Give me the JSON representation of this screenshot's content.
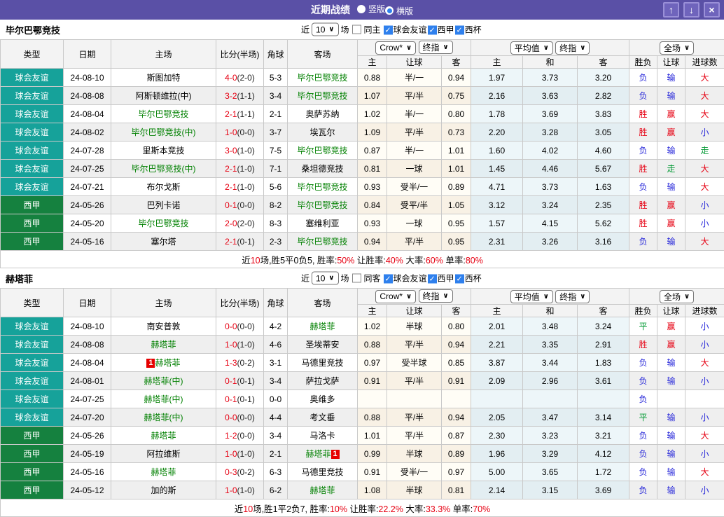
{
  "colors": {
    "titlebar": "#5A50A6",
    "badge_teal": "#16A29A",
    "badge_green": "#15813F",
    "result_red": "#E60012",
    "result_blue": "#2626D9",
    "result_green": "#009933",
    "team_green": "#008000",
    "check_blue": "#2F80ED"
  },
  "titlebar": {
    "title": "近期战绩",
    "radios": [
      {
        "label": "竖版",
        "selected": false
      },
      {
        "label": "横版",
        "selected": true
      }
    ],
    "buttons": [
      {
        "name": "scroll-up",
        "icon": "up-arrow-icon",
        "glyph": "↑"
      },
      {
        "name": "scroll-down",
        "icon": "down-arrow-icon",
        "glyph": "↓"
      },
      {
        "name": "close",
        "icon": "close-icon",
        "glyph": "×"
      }
    ]
  },
  "table": {
    "main_cols": [
      "类型",
      "日期",
      "主场",
      "比分(半场)",
      "角球",
      "客场"
    ],
    "sub_cols": [
      "主",
      "让球",
      "客",
      "主",
      "和",
      "客",
      "胜负",
      "让球",
      "进球数"
    ],
    "selects": {
      "bookmaker": "Crow*",
      "final1": "终指",
      "average": "平均值",
      "final2": "终指",
      "scope": "全场"
    }
  },
  "sections": [
    {
      "team": "毕尔巴鄂竞技",
      "filter": {
        "near": "近",
        "count": "10",
        "games": "场",
        "same": "同主",
        "same_checked": false,
        "leagues": [
          {
            "label": "球会友谊",
            "checked": true
          },
          {
            "label": "西甲",
            "checked": true
          },
          {
            "label": "西杯",
            "checked": true
          }
        ]
      },
      "rows": [
        {
          "type": "球会友谊",
          "tc": "teal",
          "date": "24-08-10",
          "home": {
            "t": "斯图加特"
          },
          "score": "4-0",
          "half": "(2-0)",
          "corner": "5-3",
          "away": {
            "t": "毕尔巴鄂竞技",
            "g": 1
          },
          "odds": [
            "0.88",
            "半/一",
            "0.94"
          ],
          "avg": [
            "1.97",
            "3.73",
            "3.20"
          ],
          "res": [
            [
              "负",
              "b"
            ],
            [
              "输",
              "b"
            ],
            [
              "大",
              "r"
            ]
          ]
        },
        {
          "type": "球会友谊",
          "tc": "teal",
          "date": "24-08-08",
          "home": {
            "t": "阿斯顿维拉(中)"
          },
          "score": "3-2",
          "half": "(1-1)",
          "corner": "3-4",
          "away": {
            "t": "毕尔巴鄂竞技",
            "g": 1
          },
          "odds": [
            "1.07",
            "平/半",
            "0.75"
          ],
          "avg": [
            "2.16",
            "3.63",
            "2.82"
          ],
          "res": [
            [
              "负",
              "b"
            ],
            [
              "输",
              "b"
            ],
            [
              "大",
              "r"
            ]
          ]
        },
        {
          "type": "球会友谊",
          "tc": "teal",
          "date": "24-08-04",
          "home": {
            "t": "毕尔巴鄂竞技",
            "g": 1
          },
          "score": "2-1",
          "half": "(1-1)",
          "corner": "2-1",
          "away": {
            "t": "奥萨苏纳"
          },
          "odds": [
            "1.02",
            "半/一",
            "0.80"
          ],
          "avg": [
            "1.78",
            "3.69",
            "3.83"
          ],
          "res": [
            [
              "胜",
              "r"
            ],
            [
              "赢",
              "r"
            ],
            [
              "大",
              "r"
            ]
          ]
        },
        {
          "type": "球会友谊",
          "tc": "teal",
          "date": "24-08-02",
          "home": {
            "t": "毕尔巴鄂竞技(中)",
            "g": 1
          },
          "score": "1-0",
          "half": "(0-0)",
          "corner": "3-7",
          "away": {
            "t": "埃瓦尔"
          },
          "odds": [
            "1.09",
            "平/半",
            "0.73"
          ],
          "avg": [
            "2.20",
            "3.28",
            "3.05"
          ],
          "res": [
            [
              "胜",
              "r"
            ],
            [
              "赢",
              "r"
            ],
            [
              "小",
              "b"
            ]
          ]
        },
        {
          "type": "球会友谊",
          "tc": "teal",
          "date": "24-07-28",
          "home": {
            "t": "里斯本竞技"
          },
          "score": "3-0",
          "half": "(1-0)",
          "corner": "7-5",
          "away": {
            "t": "毕尔巴鄂竞技",
            "g": 1
          },
          "odds": [
            "0.87",
            "半/一",
            "1.01"
          ],
          "avg": [
            "1.60",
            "4.02",
            "4.60"
          ],
          "res": [
            [
              "负",
              "b"
            ],
            [
              "输",
              "b"
            ],
            [
              "走",
              "g"
            ]
          ]
        },
        {
          "type": "球会友谊",
          "tc": "teal",
          "date": "24-07-25",
          "home": {
            "t": "毕尔巴鄂竞技(中)",
            "g": 1
          },
          "score": "2-1",
          "half": "(1-0)",
          "corner": "7-1",
          "away": {
            "t": "桑坦德竞技"
          },
          "odds": [
            "0.81",
            "一球",
            "1.01"
          ],
          "avg": [
            "1.45",
            "4.46",
            "5.67"
          ],
          "res": [
            [
              "胜",
              "r"
            ],
            [
              "走",
              "g"
            ],
            [
              "大",
              "r"
            ]
          ]
        },
        {
          "type": "球会友谊",
          "tc": "teal",
          "date": "24-07-21",
          "home": {
            "t": "布尔戈斯"
          },
          "score": "2-1",
          "half": "(1-0)",
          "corner": "5-6",
          "away": {
            "t": "毕尔巴鄂竞技",
            "g": 1
          },
          "odds": [
            "0.93",
            "受半/一",
            "0.89"
          ],
          "avg": [
            "4.71",
            "3.73",
            "1.63"
          ],
          "res": [
            [
              "负",
              "b"
            ],
            [
              "输",
              "b"
            ],
            [
              "大",
              "r"
            ]
          ]
        },
        {
          "type": "西甲",
          "tc": "green",
          "date": "24-05-26",
          "home": {
            "t": "巴列卡诺"
          },
          "score": "0-1",
          "half": "(0-0)",
          "corner": "8-2",
          "away": {
            "t": "毕尔巴鄂竞技",
            "g": 1
          },
          "odds": [
            "0.84",
            "受平/半",
            "1.05"
          ],
          "avg": [
            "3.12",
            "3.24",
            "2.35"
          ],
          "res": [
            [
              "胜",
              "r"
            ],
            [
              "赢",
              "r"
            ],
            [
              "小",
              "b"
            ]
          ]
        },
        {
          "type": "西甲",
          "tc": "green",
          "date": "24-05-20",
          "home": {
            "t": "毕尔巴鄂竞技",
            "g": 1
          },
          "score": "2-0",
          "half": "(2-0)",
          "corner": "8-3",
          "away": {
            "t": "塞维利亚"
          },
          "odds": [
            "0.93",
            "一球",
            "0.95"
          ],
          "avg": [
            "1.57",
            "4.15",
            "5.62"
          ],
          "res": [
            [
              "胜",
              "r"
            ],
            [
              "赢",
              "r"
            ],
            [
              "小",
              "b"
            ]
          ]
        },
        {
          "type": "西甲",
          "tc": "green",
          "date": "24-05-16",
          "home": {
            "t": "塞尔塔"
          },
          "score": "2-1",
          "half": "(0-1)",
          "corner": "2-3",
          "away": {
            "t": "毕尔巴鄂竞技",
            "g": 1
          },
          "odds": [
            "0.94",
            "平/半",
            "0.95"
          ],
          "avg": [
            "2.31",
            "3.26",
            "3.16"
          ],
          "res": [
            [
              "负",
              "b"
            ],
            [
              "输",
              "b"
            ],
            [
              "大",
              "r"
            ]
          ]
        }
      ],
      "summary": [
        [
          "近",
          "k"
        ],
        [
          "10",
          "r"
        ],
        [
          "场,胜5平0负5, 胜率:",
          "k"
        ],
        [
          "50%",
          "r"
        ],
        [
          " 让胜率:",
          "k"
        ],
        [
          "40%",
          "r"
        ],
        [
          " 大率:",
          "k"
        ],
        [
          "60%",
          "r"
        ],
        [
          " 单率:",
          "k"
        ],
        [
          "80%",
          "r"
        ]
      ]
    },
    {
      "team": "赫塔菲",
      "filter": {
        "near": "近",
        "count": "10",
        "games": "场",
        "same": "同客",
        "same_checked": false,
        "leagues": [
          {
            "label": "球会友谊",
            "checked": true
          },
          {
            "label": "西甲",
            "checked": true
          },
          {
            "label": "西杯",
            "checked": true
          }
        ]
      },
      "rows": [
        {
          "type": "球会友谊",
          "tc": "teal",
          "date": "24-08-10",
          "home": {
            "t": "南安普敦"
          },
          "score": "0-0",
          "half": "(0-0)",
          "corner": "4-2",
          "away": {
            "t": "赫塔菲",
            "g": 1
          },
          "odds": [
            "1.02",
            "半球",
            "0.80"
          ],
          "avg": [
            "2.01",
            "3.48",
            "3.24"
          ],
          "res": [
            [
              "平",
              "g"
            ],
            [
              "赢",
              "r"
            ],
            [
              "小",
              "b"
            ]
          ]
        },
        {
          "type": "球会友谊",
          "tc": "teal",
          "date": "24-08-08",
          "home": {
            "t": "赫塔菲",
            "g": 1
          },
          "score": "1-0",
          "half": "(1-0)",
          "corner": "4-6",
          "away": {
            "t": "圣埃蒂安"
          },
          "odds": [
            "0.88",
            "平/半",
            "0.94"
          ],
          "avg": [
            "2.21",
            "3.35",
            "2.91"
          ],
          "res": [
            [
              "胜",
              "r"
            ],
            [
              "赢",
              "r"
            ],
            [
              "小",
              "b"
            ]
          ]
        },
        {
          "type": "球会友谊",
          "tc": "teal",
          "date": "24-08-04",
          "home": {
            "t": "赫塔菲",
            "g": 1,
            "rc": {
              "text": "1",
              "pos": "before"
            }
          },
          "score": "1-3",
          "half": "(0-2)",
          "corner": "3-1",
          "away": {
            "t": "马德里竞技"
          },
          "odds": [
            "0.97",
            "受半球",
            "0.85"
          ],
          "avg": [
            "3.87",
            "3.44",
            "1.83"
          ],
          "res": [
            [
              "负",
              "b"
            ],
            [
              "输",
              "b"
            ],
            [
              "大",
              "r"
            ]
          ]
        },
        {
          "type": "球会友谊",
          "tc": "teal",
          "date": "24-08-01",
          "home": {
            "t": "赫塔菲(中)",
            "g": 1
          },
          "score": "0-1",
          "half": "(0-1)",
          "corner": "3-4",
          "away": {
            "t": "萨拉戈萨"
          },
          "odds": [
            "0.91",
            "平/半",
            "0.91"
          ],
          "avg": [
            "2.09",
            "2.96",
            "3.61"
          ],
          "res": [
            [
              "负",
              "b"
            ],
            [
              "输",
              "b"
            ],
            [
              "小",
              "b"
            ]
          ]
        },
        {
          "type": "球会友谊",
          "tc": "teal",
          "date": "24-07-25",
          "home": {
            "t": "赫塔菲(中)",
            "g": 1
          },
          "score": "0-1",
          "half": "(0-1)",
          "corner": "0-0",
          "away": {
            "t": "奥维多"
          },
          "odds": [
            "",
            "",
            ""
          ],
          "avg": [
            "",
            "",
            ""
          ],
          "res": [
            [
              "负",
              "b"
            ],
            [
              "",
              ""
            ],
            [
              "",
              ""
            ]
          ]
        },
        {
          "type": "球会友谊",
          "tc": "teal",
          "date": "24-07-20",
          "home": {
            "t": "赫塔菲(中)",
            "g": 1
          },
          "score": "0-0",
          "half": "(0-0)",
          "corner": "4-4",
          "away": {
            "t": "考文垂"
          },
          "odds": [
            "0.88",
            "平/半",
            "0.94"
          ],
          "avg": [
            "2.05",
            "3.47",
            "3.14"
          ],
          "res": [
            [
              "平",
              "g"
            ],
            [
              "输",
              "b"
            ],
            [
              "小",
              "b"
            ]
          ]
        },
        {
          "type": "西甲",
          "tc": "green",
          "date": "24-05-26",
          "home": {
            "t": "赫塔菲",
            "g": 1
          },
          "score": "1-2",
          "half": "(0-0)",
          "corner": "3-4",
          "away": {
            "t": "马洛卡"
          },
          "odds": [
            "1.01",
            "平/半",
            "0.87"
          ],
          "avg": [
            "2.30",
            "3.23",
            "3.21"
          ],
          "res": [
            [
              "负",
              "b"
            ],
            [
              "输",
              "b"
            ],
            [
              "大",
              "r"
            ]
          ]
        },
        {
          "type": "西甲",
          "tc": "green",
          "date": "24-05-19",
          "home": {
            "t": "阿拉维斯"
          },
          "score": "1-0",
          "half": "(1-0)",
          "corner": "2-1",
          "away": {
            "t": "赫塔菲",
            "g": 1,
            "rc": {
              "text": "1",
              "pos": "after"
            }
          },
          "odds": [
            "0.99",
            "半球",
            "0.89"
          ],
          "avg": [
            "1.96",
            "3.29",
            "4.12"
          ],
          "res": [
            [
              "负",
              "b"
            ],
            [
              "输",
              "b"
            ],
            [
              "小",
              "b"
            ]
          ]
        },
        {
          "type": "西甲",
          "tc": "green",
          "date": "24-05-16",
          "home": {
            "t": "赫塔菲",
            "g": 1
          },
          "score": "0-3",
          "half": "(0-2)",
          "corner": "6-3",
          "away": {
            "t": "马德里竞技"
          },
          "odds": [
            "0.91",
            "受半/一",
            "0.97"
          ],
          "avg": [
            "5.00",
            "3.65",
            "1.72"
          ],
          "res": [
            [
              "负",
              "b"
            ],
            [
              "输",
              "b"
            ],
            [
              "大",
              "r"
            ]
          ]
        },
        {
          "type": "西甲",
          "tc": "green",
          "date": "24-05-12",
          "home": {
            "t": "加的斯"
          },
          "score": "1-0",
          "half": "(1-0)",
          "corner": "6-2",
          "away": {
            "t": "赫塔菲",
            "g": 1
          },
          "odds": [
            "1.08",
            "半球",
            "0.81"
          ],
          "avg": [
            "2.14",
            "3.15",
            "3.69"
          ],
          "res": [
            [
              "负",
              "b"
            ],
            [
              "输",
              "b"
            ],
            [
              "小",
              "b"
            ]
          ]
        }
      ],
      "summary": [
        [
          "近",
          "k"
        ],
        [
          "10",
          "r"
        ],
        [
          "场,胜1平2负7, 胜率:",
          "k"
        ],
        [
          "10%",
          "r"
        ],
        [
          " 让胜率:",
          "k"
        ],
        [
          "22.2%",
          "r"
        ],
        [
          " 大率:",
          "k"
        ],
        [
          "33.3%",
          "r"
        ],
        [
          " 单率:",
          "k"
        ],
        [
          "70%",
          "r"
        ]
      ]
    }
  ]
}
